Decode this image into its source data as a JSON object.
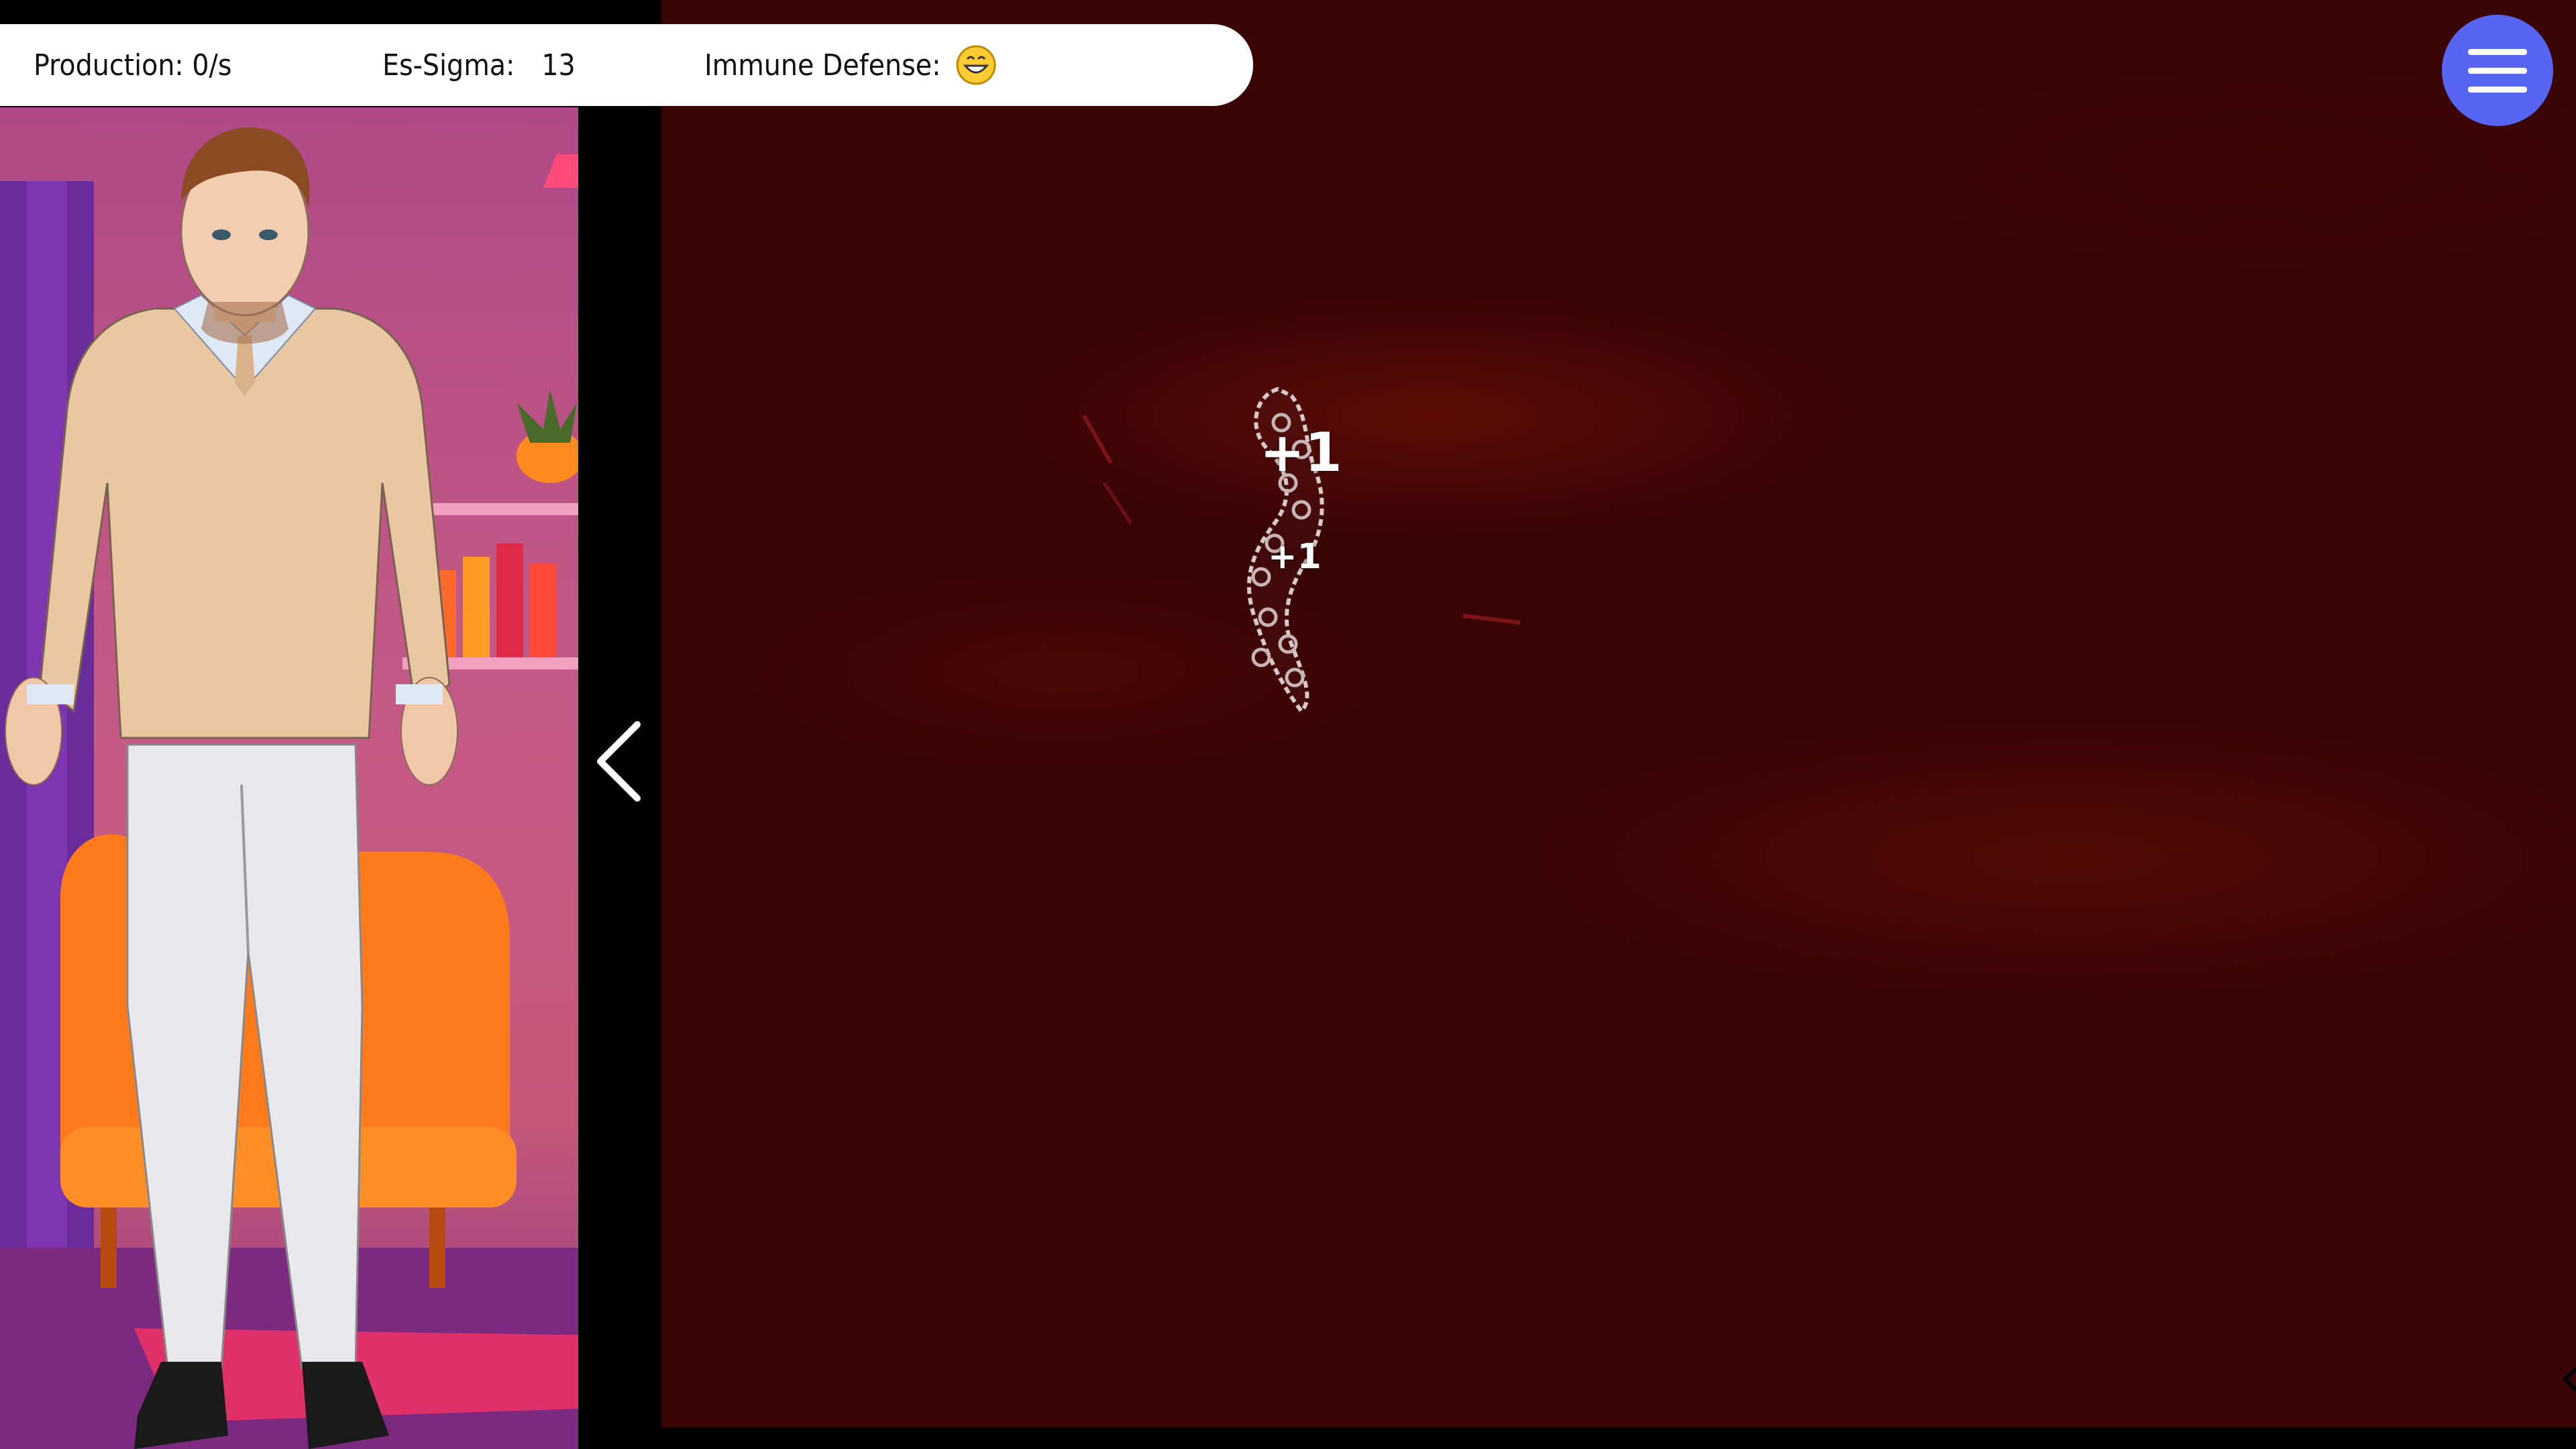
{
  "hud": {
    "production": "Production: 0/s",
    "sigma_label": "Es-Sigma:",
    "sigma_value": "13",
    "immune_label": "Immune Defense:",
    "immune_icon": "grinning-face-icon"
  },
  "menu": {
    "icon": "hamburger-menu-icon",
    "color": "#5865f2"
  },
  "game": {
    "pops": [
      "+1",
      "+1"
    ],
    "germ_icon": "bacterium-icon",
    "background_color": "#3a0405"
  },
  "sidebar": {
    "collapse_icon": "chevron-left-icon",
    "avatar_icon": "character-avatar"
  }
}
